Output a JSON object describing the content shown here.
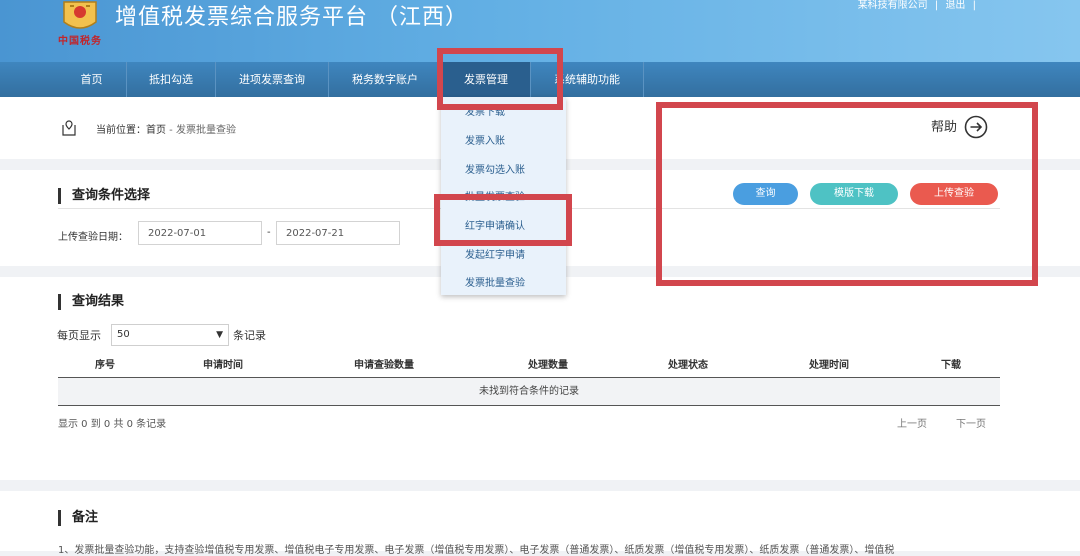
{
  "header": {
    "title": "增值税发票综合服务平台 （江西）",
    "logo_sub": "中国税务",
    "company": "某科技有限公司",
    "logout": "退出",
    "sep": "|"
  },
  "nav": {
    "items": [
      {
        "label": "首页"
      },
      {
        "label": "抵扣勾选"
      },
      {
        "label": "进项发票查询"
      },
      {
        "label": "税务数字账户"
      },
      {
        "label": "发票管理"
      },
      {
        "label": "系统辅助功能"
      }
    ],
    "active": "发票管理"
  },
  "dropdown": {
    "items": [
      {
        "label": "发票下载"
      },
      {
        "label": "发票入账"
      },
      {
        "label": "发票勾选入账"
      },
      {
        "label": "批量发票查验"
      },
      {
        "label": "红字申请确认"
      },
      {
        "label": "发起红字申请"
      },
      {
        "label": "发票批量查验"
      }
    ]
  },
  "breadcrumb": {
    "prefix": "当前位置：",
    "home": "首页",
    "sep": " - ",
    "current": "发票批量查验"
  },
  "help": {
    "label": "帮助"
  },
  "query": {
    "title": "查询条件选择",
    "date_label": "上传查验日期：",
    "date_from": "2022-07-01",
    "date_to": "2022-07-21",
    "range_sep": "-",
    "buttons": {
      "query": "查询",
      "template": "模版下载",
      "upload": "上传查验"
    }
  },
  "results": {
    "title": "查询结果",
    "per_page_label": "每页显示",
    "per_page_value": "50",
    "per_page_unit": "条记录",
    "columns": [
      "序号",
      "申请时间",
      "申请查验数量",
      "处理数量",
      "处理状态",
      "处理时间",
      "下载"
    ],
    "empty_text": "未找到符合条件的记录",
    "summary": "显示 0 到 0 共 0 条记录",
    "prev": "上一页",
    "next": "下一页"
  },
  "notes": {
    "title": "备注",
    "text": "1、发票批量查验功能，支持查验增值税专用发票、增值税电子专用发票、电子发票（增值税专用发票）、电子发票（普通发票）、纸质发票（增值税专用发票）、纸质发票（普通发票）、增值税"
  },
  "colors": {
    "header_start": "#4a95d2",
    "nav": "#3a7fb6",
    "btn_query": "#4a9ee0",
    "btn_template": "#4ec2c4",
    "btn_upload": "#ea5a4f",
    "annotation_red": "#d2464d"
  }
}
